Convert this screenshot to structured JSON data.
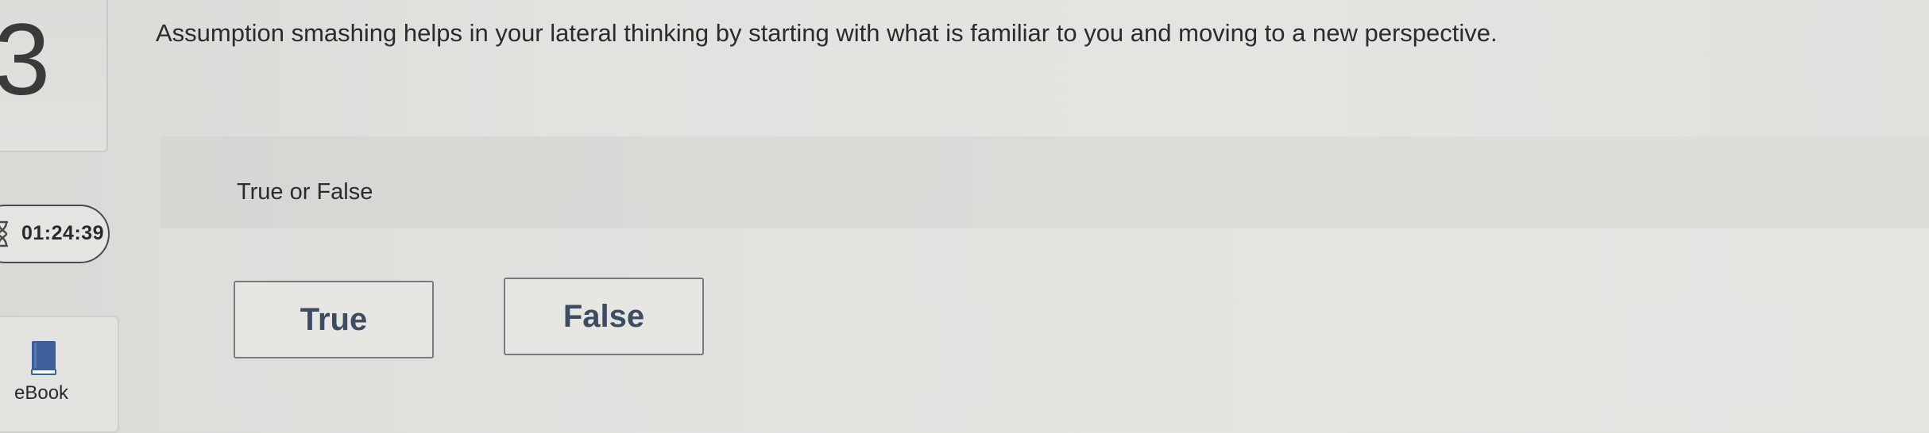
{
  "question": {
    "number": "3",
    "text": "Assumption smashing helps in your lateral thinking by starting with what is familiar to you and moving to a new perspective.",
    "type_label": "True or False"
  },
  "timer": {
    "value": "01:24:39",
    "icon": "hourglass-icon"
  },
  "ebook": {
    "label": "eBook",
    "icon": "book-icon",
    "icon_color": "#3f5f9c"
  },
  "choices": [
    {
      "label": "True"
    },
    {
      "label": "False"
    }
  ],
  "colors": {
    "choice_text": "#3d4b63",
    "background": "#e2e2df"
  }
}
